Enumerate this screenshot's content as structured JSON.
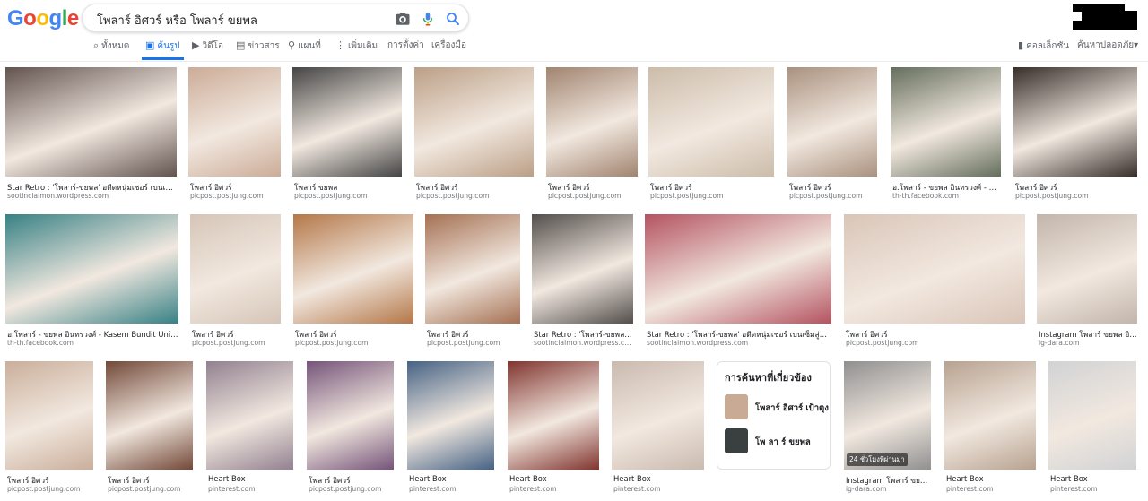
{
  "logo": [
    "G",
    "o",
    "o",
    "g",
    "l",
    "e"
  ],
  "logo_colors": [
    "#4285f4",
    "#ea4335",
    "#fbbc05",
    "#4285f4",
    "#34a853",
    "#ea4335"
  ],
  "search": {
    "query": "โพลาร์ อิศวร์ หรือ โพลาร์ ขยพล"
  },
  "tabs": [
    "ทั้งหมด",
    "ค้นรูป",
    "วิดีโอ",
    "ข่าวสาร",
    "แผนที่",
    "เพิ่มเติม",
    "การตั้งค่า",
    "เครื่องมือ"
  ],
  "tab_icons": [
    "search-icon",
    "image-icon",
    "video-icon",
    "news-icon",
    "map-pin-icon",
    "more-icon",
    "",
    ""
  ],
  "active_tab": "ค้นรูป",
  "right_links": {
    "collections": "คอลเล็กชัน",
    "safesearch": "ค้นหาปลอดภัย▾"
  },
  "results": [
    {
      "caption": "Star Retro : 'โพลาร์-ขยพล' อดีตหนุ่มเชอร์ เบนเซ็มสู่...",
      "source": "sootinclaimon.wordpress.com",
      "color": "#5a4a46"
    },
    {
      "caption": "โพลาร์ อิศวร์",
      "source": "picpost.postjung.com",
      "color": "#c9a792"
    },
    {
      "caption": "โพลาร์ ขยพล",
      "source": "picpost.postjung.com",
      "color": "#3b3b3b"
    },
    {
      "caption": "โพลาร์ อิศวร์",
      "source": "picpost.postjung.com",
      "color": "#b89a80"
    },
    {
      "caption": "โพลาร์ อิศวร์",
      "source": "picpost.postjung.com",
      "color": "#9c7d68"
    },
    {
      "caption": "โพลาร์ อิศวร์",
      "source": "picpost.postjung.com",
      "color": "#c9b9a5"
    },
    {
      "caption": "โพลาร์ อิศวร์",
      "source": "picpost.postjung.com",
      "color": "#a58b78"
    },
    {
      "caption": "อ.โพลาร์ - ขยพล อินทรวงศ์ - K...",
      "source": "th-th.facebook.com",
      "color": "#5c6653"
    },
    {
      "caption": "โพลาร์ อิศวร์",
      "source": "picpost.postjung.com",
      "color": "#2d2420"
    },
    {
      "caption": "อ.โพลาร์ - ขยพล อินทรวงศ์ - Kasem Bundit Unive...",
      "source": "th-th.facebook.com",
      "color": "#2d7a7e"
    },
    {
      "caption": "โพลาร์ อิศวร์",
      "source": "picpost.postjung.com",
      "color": "#d3c2b3"
    },
    {
      "caption": "โพลาร์ อิศวร์",
      "source": "picpost.postjung.com",
      "color": "#b0703f"
    },
    {
      "caption": "โพลาร์ อิศวร์",
      "source": "picpost.postjung.com",
      "color": "#a0694a"
    },
    {
      "caption": "Star Retro : 'โพลาร์-ขยพล' อดีตหนุ่ม...",
      "source": "sootinclaimon.wordpress.com",
      "color": "#4a4542"
    },
    {
      "caption": "Star Retro : 'โพลาร์-ขยพล' อดีตหนุ่มเชอร์ เบนเซ็มสู่อาจิพ...",
      "source": "sootinclaimon.wordpress.com",
      "color": "#b04a58"
    },
    {
      "caption": "โพลาร์ อิศวร์",
      "source": "picpost.postjung.com",
      "color": "#d8c2b4"
    },
    {
      "caption": "Instagram โพลาร์ ขยพล อิน...",
      "source": "ig-dara.com",
      "color": "#bfb1a6"
    },
    {
      "caption": "โพลาร์ อิศวร์",
      "source": "picpost.postjung.com",
      "color": "#c7aa95"
    },
    {
      "caption": "โพลาร์ อิศวร์",
      "source": "picpost.postjung.com",
      "color": "#6b3f2e"
    },
    {
      "caption": "Heart Box",
      "source": "pinterest.com",
      "color": "#8c7a8a"
    },
    {
      "caption": "โพลาร์ อิศวร์",
      "source": "picpost.postjung.com",
      "color": "#6e4b72"
    },
    {
      "caption": "Heart Box",
      "source": "pinterest.com",
      "color": "#3c5a7e"
    },
    {
      "caption": "Heart Box",
      "source": "pinterest.com",
      "color": "#7a2a24"
    },
    {
      "caption": "Heart Box",
      "source": "pinterest.com",
      "color": "#c7b6ab"
    },
    {
      "caption": "Instagram โพลาร์ ขยพล...",
      "source": "ig-dara.com",
      "color": "#8a8a8a",
      "stamp": "24 ชั่วโมงที่ผ่านมา"
    },
    {
      "caption": "Heart Box",
      "source": "pinterest.com",
      "color": "#b39d8a"
    },
    {
      "caption": "Heart Box",
      "source": "pinterest.com",
      "color": "#cfd0d2"
    }
  ],
  "related": {
    "heading": "การค้นหาที่เกี่ยวข้อง",
    "items": [
      {
        "label": "โพลาร์ อิศวร์ เป้าตุง",
        "color": "#c9ab95"
      },
      {
        "label": "โพ ลา ร์ ขยพล",
        "color": "#3a3f40"
      }
    ]
  }
}
